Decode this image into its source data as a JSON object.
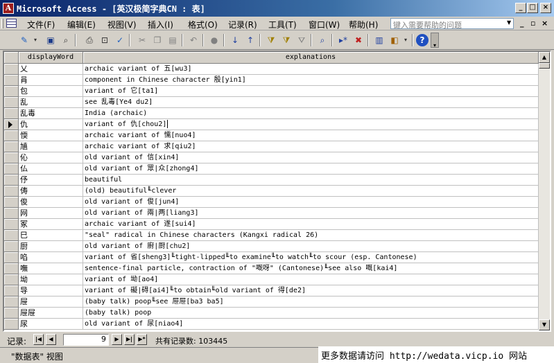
{
  "window": {
    "title": "Microsoft Access - [英汉极简字典CN : 表]",
    "app_icon_letter": "A",
    "controls": [
      "_",
      "□",
      "×"
    ]
  },
  "menubar": {
    "items": [
      "文件(F)",
      "编辑(E)",
      "视图(V)",
      "插入(I)",
      "格式(O)",
      "记录(R)",
      "工具(T)",
      "窗口(W)",
      "帮助(H)"
    ],
    "help_placeholder": "键入需要帮助的问题",
    "mdi_controls": [
      "_",
      "▫",
      "×"
    ]
  },
  "datasheet": {
    "columns": [
      "displayWord",
      "explanations"
    ],
    "current_row": 5,
    "rows": [
      [
        "乂",
        "archaic variant of 五[wu3]"
      ],
      [
        "肙",
        "component in Chinese character 殷[yin1]"
      ],
      [
        "包",
        "variant of 它[ta1]"
      ],
      [
        "乱",
        "see 乱毒[Ye4 du2]"
      ],
      [
        "乱毒",
        "India (archaic)"
      ],
      [
        "仇",
        "variant of 仇[chou2]"
      ],
      [
        "愞",
        "archaic variant of 懦[nuo4]"
      ],
      [
        "㐤",
        "archaic variant of 求[qiu2]"
      ],
      [
        "伈",
        "old variant of 信[xin4]"
      ],
      [
        "仏",
        "old variant of 眾|众[zhong4]"
      ],
      [
        "伃",
        "beautiful"
      ],
      [
        "俦",
        "(old) beautiful╙clever"
      ],
      [
        "俊",
        "old variant of 俊[jun4]"
      ],
      [
        "网",
        "old variant of 兩|两[liang3]"
      ],
      [
        "冢",
        "archaic variant of 遂[sui4]"
      ],
      [
        "巳",
        "\"seal\" radical in Chinese characters (Kangxi radical 26)"
      ],
      [
        "厨",
        "old variant of 廚|厨[chu2]"
      ],
      [
        "啗",
        "variant of 省[sheng3]╙tight-lipped╙to examine╙to watch╙to scour (esp. Cantonese)"
      ],
      [
        "嘸",
        "sentence-final particle, contraction of \"嘅呀\" (Cantonese)╙see also 嘅[kai4]"
      ],
      [
        "坳",
        "variant of 坳[ao4]"
      ],
      [
        "导",
        "variant of 礙|碍[ai4]╙to obtain╙old variant of 得[de2]"
      ],
      [
        "屉",
        "(baby talk) poop╙see 屉屉[ba3 ba5]"
      ],
      [
        "屉屉",
        "(baby talk) poop"
      ],
      [
        "尿",
        "old variant of 尿[niao4]"
      ]
    ]
  },
  "navigation": {
    "label": "记录:",
    "current_record": "9",
    "total_text": "共有记录数: 103445",
    "buttons": [
      "first",
      "previous",
      "next",
      "last",
      "new"
    ]
  },
  "statusbar": {
    "view_text": "\"数据表\" 视图"
  },
  "watermark": {
    "text": "更多数据请访问 http://wedata.vicp.io 网站"
  }
}
